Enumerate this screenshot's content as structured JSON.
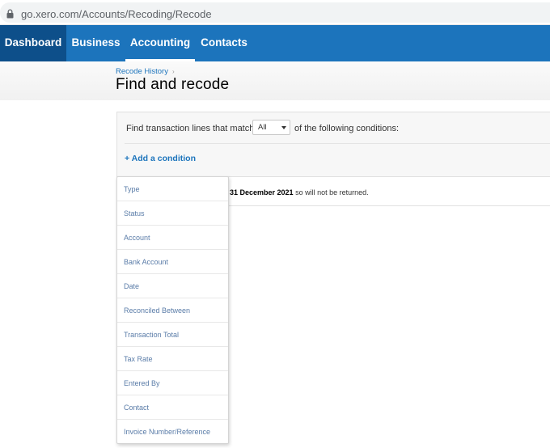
{
  "browser": {
    "url": "go.xero.com/Accounts/Recoding/Recode"
  },
  "nav": {
    "items": [
      {
        "label": "Dashboard"
      },
      {
        "label": "Business"
      },
      {
        "label": "Accounting"
      },
      {
        "label": "Contacts"
      }
    ],
    "active": "Accounting"
  },
  "header": {
    "breadcrumb": "Recode History",
    "breadcrumb_sep": "›",
    "title": "Find and recode"
  },
  "filter": {
    "find_label": "Find transaction lines that match",
    "match_value": "All",
    "conditions_label": "of the following conditions:",
    "add_condition": "+ Add a condition"
  },
  "info": {
    "date": "31 December 2021",
    "suffix": "so will not be returned."
  },
  "dropdown": {
    "items": [
      {
        "label": "Type"
      },
      {
        "label": "Status"
      },
      {
        "label": "Account"
      },
      {
        "label": "Bank Account"
      },
      {
        "label": "Date"
      },
      {
        "label": "Reconciled Between"
      },
      {
        "label": "Transaction Total"
      },
      {
        "label": "Tax Rate"
      },
      {
        "label": "Entered By"
      },
      {
        "label": "Contact"
      },
      {
        "label": "Invoice Number/Reference"
      }
    ]
  },
  "colors": {
    "nav_bg": "#1c74bc",
    "nav_active_bg": "#0d4f8a",
    "link": "#1c74bc",
    "dropdown_text": "#5a7ca8"
  }
}
